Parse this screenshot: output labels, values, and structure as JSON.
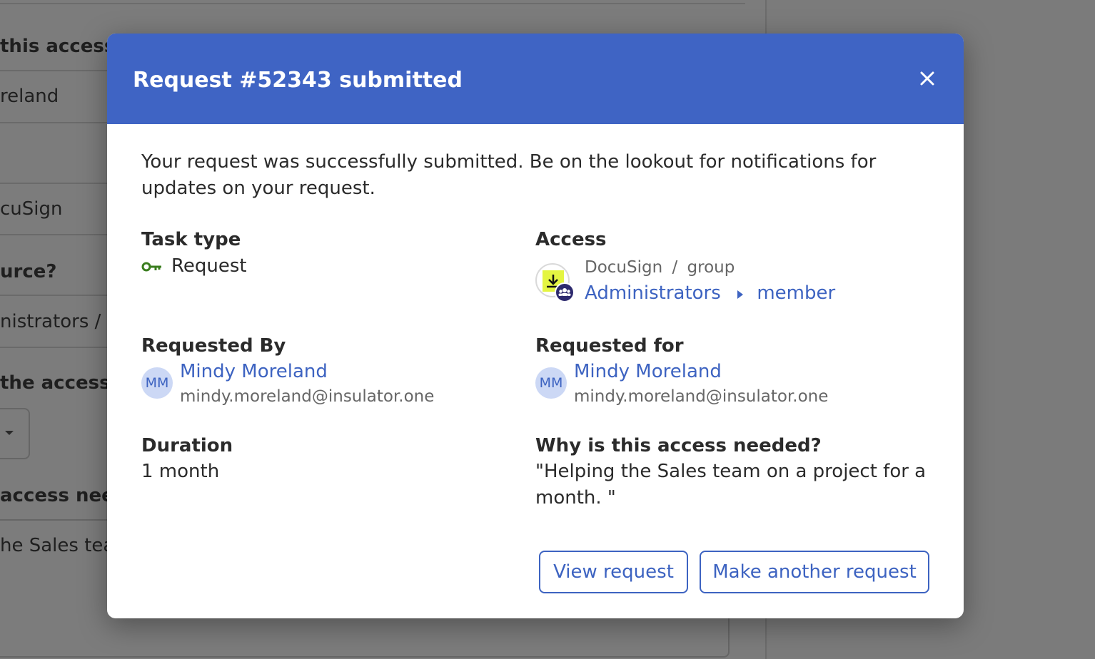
{
  "background": {
    "fragments": [
      "this access?",
      "reland",
      "cuSign",
      "urce?",
      "nistrators / r",
      "the access r",
      "access need",
      "he Sales team"
    ]
  },
  "modal": {
    "title": "Request #52343 submitted",
    "close_icon": "close-icon",
    "intro": "Your request was successfully submitted. Be on the lookout for notifications for updates on your request.",
    "task_type": {
      "label": "Task type",
      "icon": "key-icon",
      "value": "Request"
    },
    "access": {
      "label": "Access",
      "app": "DocuSign",
      "separator": "/",
      "kind": "group",
      "resource": "Administrators",
      "chevron": "chevron-right-icon",
      "role": "member"
    },
    "requested_by": {
      "label": "Requested By",
      "initials": "MM",
      "name": "Mindy Moreland",
      "email": "mindy.moreland@insulator.one"
    },
    "requested_for": {
      "label": "Requested for",
      "initials": "MM",
      "name": "Mindy Moreland",
      "email": "mindy.moreland@insulator.one"
    },
    "duration": {
      "label": "Duration",
      "value": "1 month"
    },
    "justification": {
      "label": "Why is this access needed?",
      "line1": "\"Helping the Sales team on a project for a",
      "line2": "month. \""
    },
    "buttons": {
      "view": "View request",
      "another": "Make another request"
    }
  },
  "colors": {
    "header": "#3f64c4",
    "link": "#3d63c1",
    "key": "#3a7d1e",
    "avatar_bg": "#ccd8f5"
  }
}
